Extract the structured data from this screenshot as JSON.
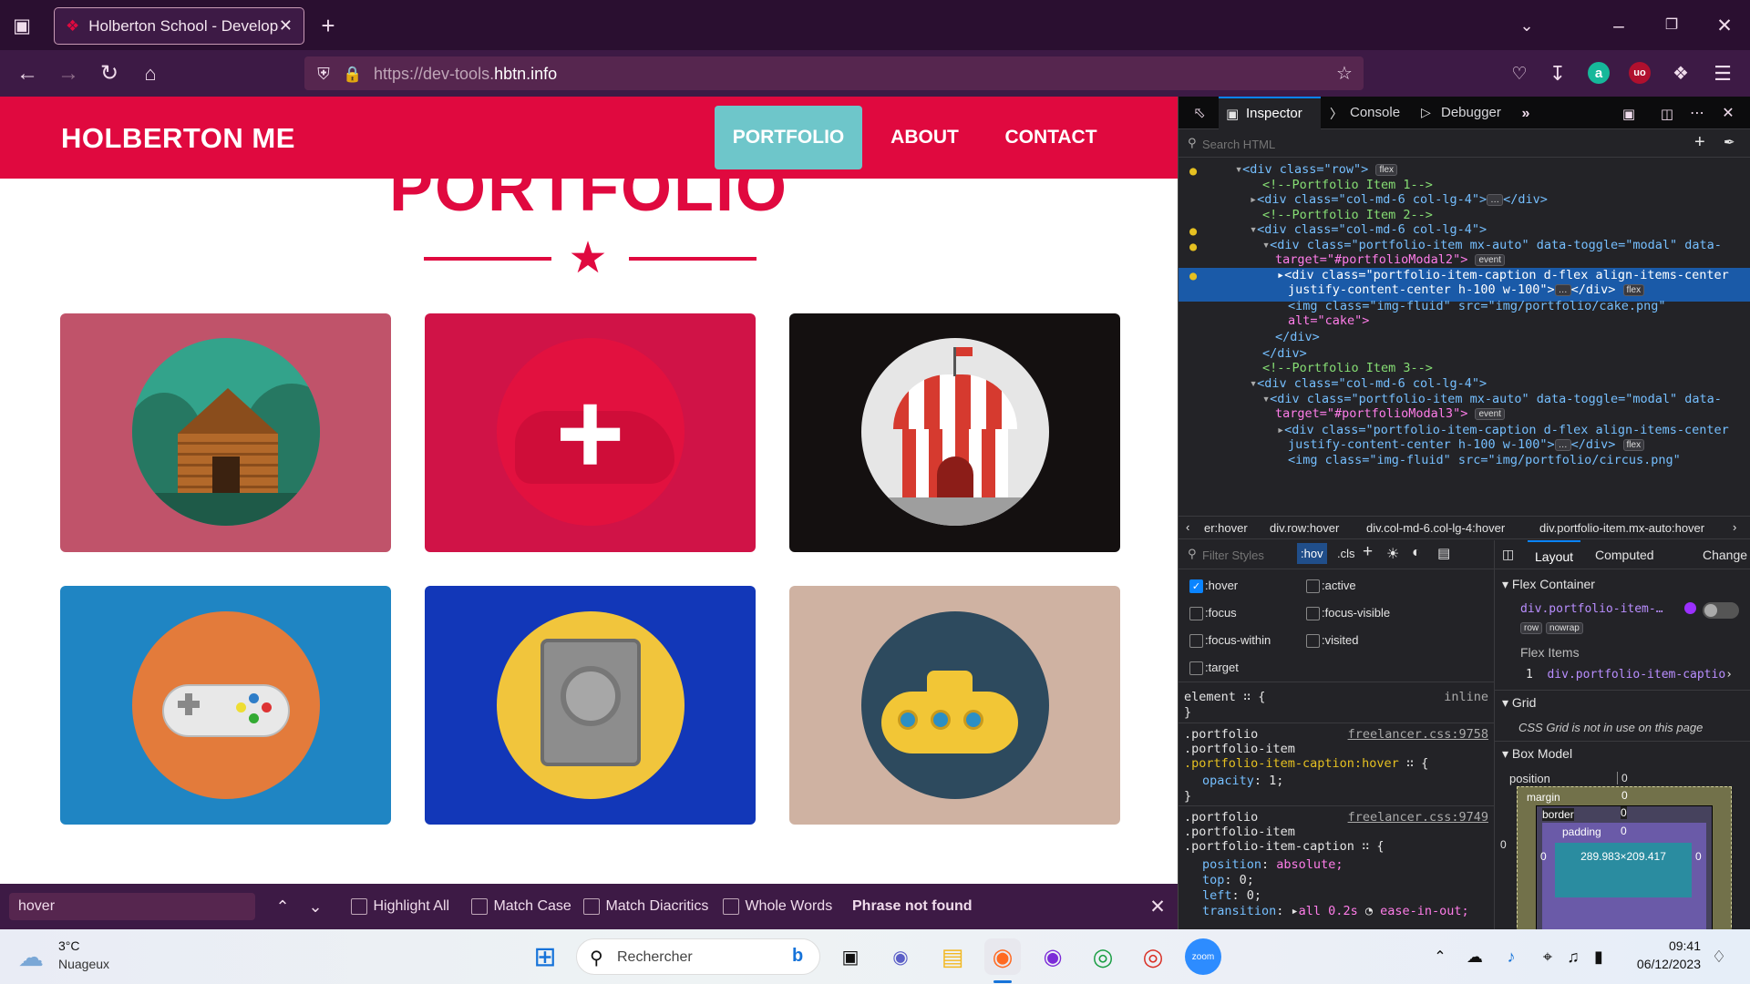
{
  "browser": {
    "tab_title": "Holberton School - Developer t",
    "url_prefix": "https://dev-tools.",
    "url_domain": "hbtn.info"
  },
  "site": {
    "brand": "HOLBERTON ME",
    "nav": [
      "PORTFOLIO",
      "ABOUT",
      "CONTACT"
    ],
    "section_title": "PORTFOLIO",
    "accent": "#e0093f",
    "active_nav_bg": "#6ec6ca",
    "cards": [
      {
        "name": "cabin",
        "bg": "#c0536a"
      },
      {
        "name": "cake",
        "bg": "#d01347"
      },
      {
        "name": "circus",
        "bg": "#141010"
      },
      {
        "name": "game",
        "bg": "#1f85c3"
      },
      {
        "name": "safe",
        "bg": "#1237b8"
      },
      {
        "name": "submarine",
        "bg": "#cfb2a2"
      }
    ]
  },
  "findbar": {
    "query": "hover",
    "highlight_all": "Highlight All",
    "match_case": "Match Case",
    "match_diacritics": "Match Diacritics",
    "whole_words": "Whole Words",
    "status": "Phrase not found"
  },
  "devtools": {
    "tabs": [
      "Inspector",
      "Console",
      "Debugger"
    ],
    "search_placeholder": "Search HTML",
    "html_lines": [
      "<div class=\"row\">",
      "<!--Portfolio Item 1-->",
      "<div class=\"col-md-6 col-lg-4\">",
      "<!--Portfolio Item 2-->",
      "<div class=\"col-md-6 col-lg-4\">",
      "<div class=\"portfolio-item mx-auto\" data-toggle=\"modal\" data-",
      "target=\"#portfolioModal2\">",
      "<div class=\"portfolio-item-caption d-flex align-items-center",
      "justify-content-center h-100 w-100\">",
      "<img class=\"img-fluid\" src=\"img/portfolio/cake.png\"",
      "alt=\"cake\">",
      "</div>",
      "</div>",
      "<!--Portfolio Item 3-->",
      "<div class=\"col-md-6 col-lg-4\">",
      "<div class=\"portfolio-item mx-auto\" data-toggle=\"modal\" data-",
      "target=\"#portfolioModal3\">",
      "<div class=\"portfolio-item-caption d-flex align-items-center",
      "justify-content-center h-100 w-100\">",
      "<img class=\"img-fluid\" src=\"img/portfolio/circus.png\""
    ],
    "badges": {
      "flex": "flex",
      "event": "event",
      "ellipsis": "…"
    },
    "breadcrumbs": [
      "er:hover",
      "div.row:hover",
      "div.col-md-6.col-lg-4:hover",
      "div.portfolio-item.mx-auto:hover"
    ],
    "filter_placeholder": "Filter Styles",
    "hov": ":hov",
    "cls": ".cls",
    "pseudo": [
      ":hover",
      ":active",
      ":focus",
      ":focus-visible",
      ":focus-within",
      ":visited",
      ":target"
    ],
    "rules": {
      "element": "element",
      "inline": "inline",
      "rule1_sel": [
        ".portfolio",
        ".portfolio-item",
        ".portfolio-item-caption:hover"
      ],
      "rule1_src": "freelancer.css:9758",
      "rule1_prop": "opacity",
      "rule1_val": "1;",
      "rule2_sel": [
        ".portfolio",
        ".portfolio-item",
        ".portfolio-item-caption"
      ],
      "rule2_src": "freelancer.css:9749",
      "rule2_props": [
        [
          "position",
          "absolute;"
        ],
        [
          "top",
          "0;"
        ],
        [
          "left",
          "0;"
        ],
        [
          "transition",
          "all 0.2s"
        ]
      ],
      "rule2_ease": "ease-in-out;"
    },
    "layout_tabs": [
      "Layout",
      "Computed",
      "Change"
    ],
    "flex_container": "Flex Container",
    "flex_el": "div.portfolio-item-…",
    "flex_badges": [
      "row",
      "nowrap"
    ],
    "flex_items": "Flex Items",
    "flex_item_index": "1",
    "flex_item": "div.portfolio-item-captio",
    "grid": "Grid",
    "grid_msg": "CSS Grid is not in use on this page",
    "box_model": "Box Model",
    "position_label": "position",
    "position_val": "0",
    "margin": "margin",
    "border": "border",
    "padding": "padding",
    "zero": "0",
    "content_size": "289.983×209.417"
  },
  "taskbar": {
    "temp": "3°C",
    "weather": "Nuageux",
    "search": "Rechercher",
    "time": "09:41",
    "date": "06/12/2023"
  }
}
